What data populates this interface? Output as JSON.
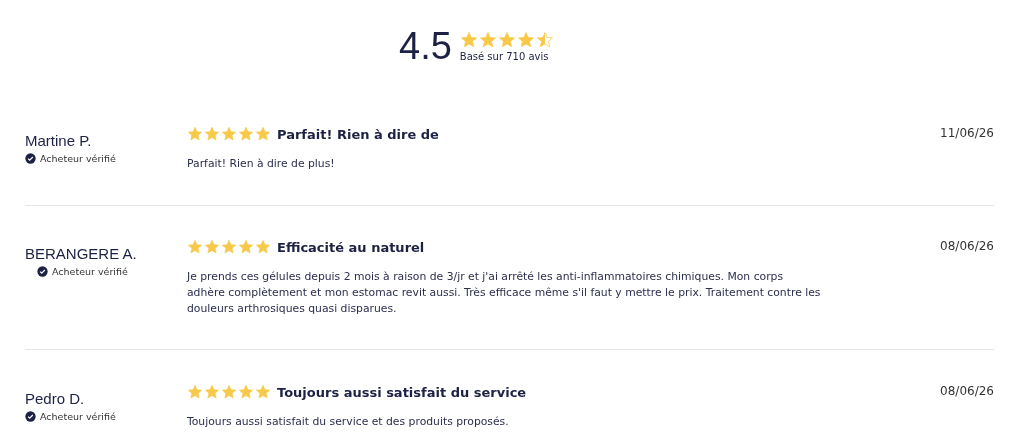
{
  "summary": {
    "score": "4.5",
    "stars": 4.5,
    "count_text": "Basé sur 710 avis"
  },
  "reviews": [
    {
      "author": "Martine P.",
      "verified": true,
      "badge": "Acheteur vérifié",
      "stars": 5,
      "title": "Parfait! Rien à dire de",
      "date": "11/06/26",
      "body": [
        "Parfait! Rien à dire de plus!"
      ]
    },
    {
      "author": "BERANGERE A.",
      "verified": true,
      "badge": "Acheteur vérifié",
      "stars": 5,
      "title": "Efficacité au naturel",
      "date": "08/06/26",
      "body": [
        "Je prends ces gélules depuis 2 mois à raison de 3/jr et j'ai arrêté les anti-inflammatoires chimiques. Mon corps",
        "adhère complètement et mon estomac revit aussi. Très efficace même s'il faut y mettre le prix. Traitement contre les",
        "douleurs arthrosiques quasi disparues."
      ]
    },
    {
      "author": "Pedro D.",
      "verified": true,
      "badge": "Acheteur vérifié",
      "stars": 5,
      "title": "Toujours aussi satisfait du service",
      "date": "08/06/26",
      "body": [
        "Toujours aussi satisfait du service et des produits proposés."
      ]
    }
  ]
}
